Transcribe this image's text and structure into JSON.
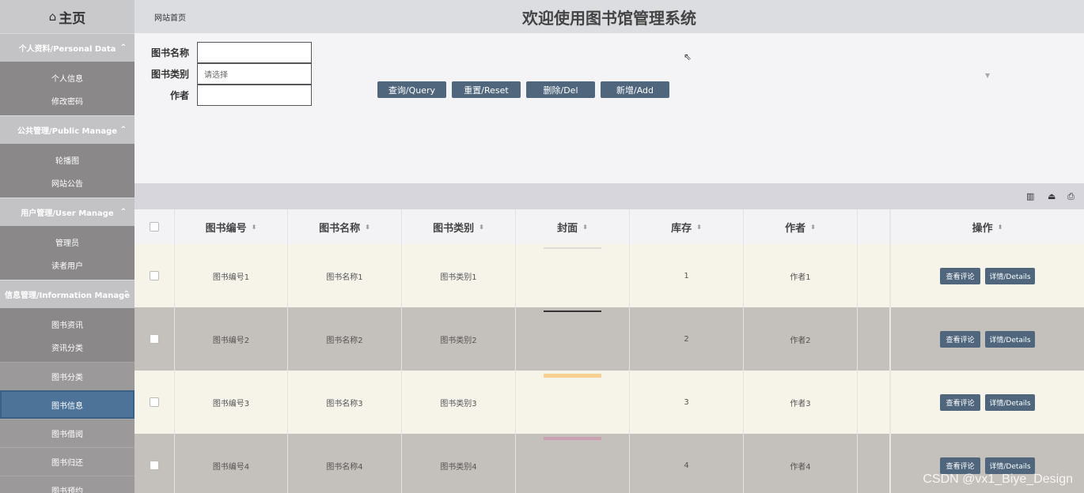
{
  "sidebar": {
    "home": "主页",
    "groups": [
      {
        "title": "个人资料/Personal Data",
        "items": [
          "个人信息",
          "修改密码"
        ]
      },
      {
        "title": "公共管理/Public Manage",
        "items": [
          "轮播图",
          "网站公告"
        ]
      },
      {
        "title": "用户管理/User Manage",
        "items": [
          "管理员",
          "读者用户"
        ]
      },
      {
        "title": "信息管理/Information Manage",
        "items": [
          "图书资讯",
          "资讯分类"
        ]
      }
    ],
    "items": [
      "图书分类",
      "图书信息",
      "图书借阅",
      "图书归还",
      "图书预约"
    ]
  },
  "header": {
    "breadcrumb": "网站首页",
    "title": "欢迎使用图书馆管理系统"
  },
  "search": {
    "name_label": "图书名称",
    "name_value": "",
    "category_label": "图书类别",
    "category_placeholder": "请选择",
    "author_label": "作者",
    "author_value": "",
    "buttons": {
      "query": "查询/Query",
      "reset": "重置/Reset",
      "delete": "删除/Del",
      "add": "新增/Add"
    }
  },
  "table": {
    "columns": [
      "图书编号",
      "图书名称",
      "图书类别",
      "封面",
      "库存",
      "作者",
      "操作"
    ],
    "rows": [
      {
        "id": "图书编号1",
        "name": "图书名称1",
        "category": "图书类别1",
        "stock": "1",
        "author": "作者1",
        "cover_color": "#dcdcdc"
      },
      {
        "id": "图书编号2",
        "name": "图书名称2",
        "category": "图书类别2",
        "stock": "2",
        "author": "作者2",
        "cover_color": "#333333"
      },
      {
        "id": "图书编号3",
        "name": "图书名称3",
        "category": "图书类别3",
        "stock": "3",
        "author": "作者3",
        "cover_color": "#f7cf90"
      },
      {
        "id": "图书编号4",
        "name": "图书名称4",
        "category": "图书类别4",
        "stock": "4",
        "author": "作者4",
        "cover_color": "#c9a0b4"
      }
    ],
    "action_review": "查看评论",
    "action_details": "详情/Details"
  },
  "watermark": "CSDN @vx1_Biye_Design"
}
